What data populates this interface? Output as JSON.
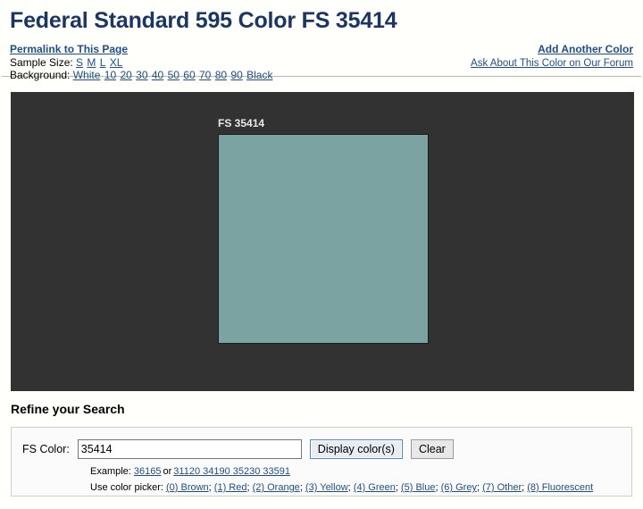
{
  "page": {
    "title": "Federal Standard 595 Color FS 35414"
  },
  "header": {
    "permalink_label": "Permalink to This Page",
    "add_another_color_label": "Add Another Color",
    "forum_label": "Ask About This Color on Our Forum",
    "sample_size_label": "Sample Size:",
    "sample_sizes": [
      "S",
      "M",
      "L",
      "XL"
    ],
    "background_label": "Background:",
    "backgrounds": [
      "White",
      "10",
      "20",
      "30",
      "40",
      "50",
      "60",
      "70",
      "80",
      "90",
      "Black"
    ]
  },
  "sample": {
    "swatch_label": "FS 35414",
    "swatch_color": "#7ba3a1",
    "panel_background": "#323232"
  },
  "refine": {
    "heading": "Refine your Search",
    "fs_color_label": "FS Color:",
    "fs_color_value": "35414",
    "fs_color_placeholder": "",
    "display_button_label": "Display color(s)",
    "clear_button_label": "Clear",
    "example_label": "Example:",
    "example_single": "36165",
    "example_or": "or",
    "example_multi": "31120 34190 35230 33591",
    "picker_label": "Use color picker:",
    "picker_options": [
      "(0) Brown",
      "(1) Red",
      "(2) Orange",
      "(3) Yellow",
      "(4) Green",
      "(5) Blue",
      "(6) Grey",
      "(7) Other",
      "(8) Fluorescent"
    ]
  },
  "colors": {
    "title_color": "#1b3663",
    "link_color": "#1f4e87",
    "swatch_color": "#7ba3a1"
  }
}
